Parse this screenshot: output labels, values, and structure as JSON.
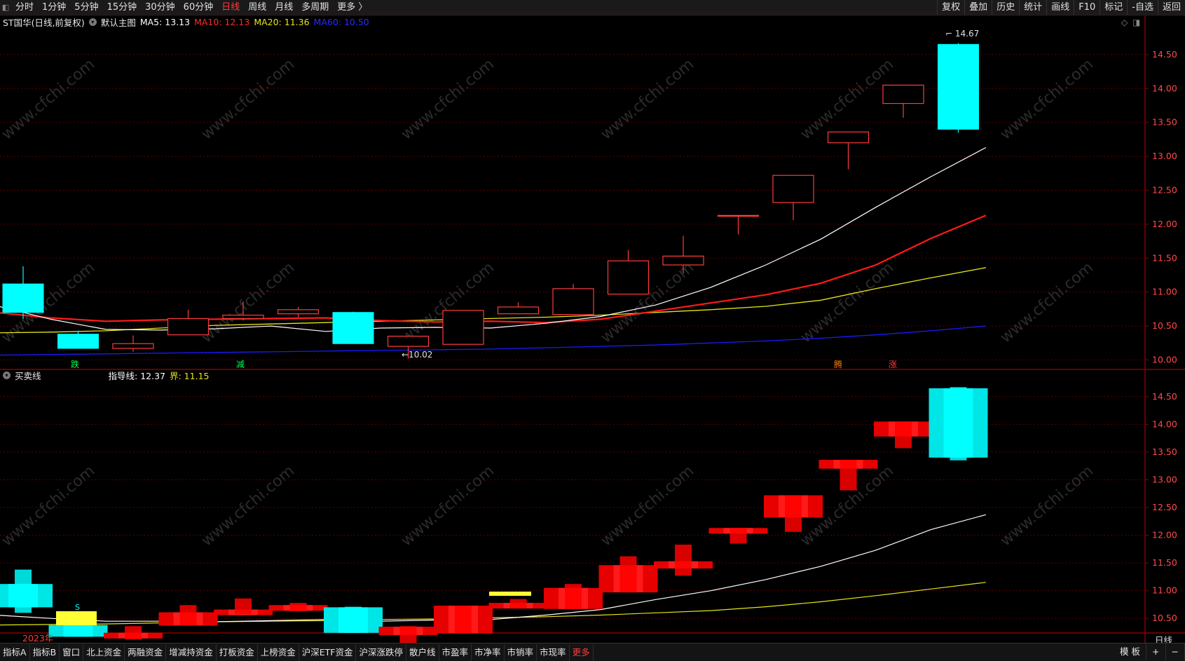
{
  "toolbar": {
    "periods": [
      "分时",
      "1分钟",
      "5分钟",
      "15分钟",
      "30分钟",
      "60分钟",
      "日线",
      "周线",
      "月线",
      "多周期",
      "更多 〉"
    ],
    "active_period": "日线",
    "right_items": [
      "复权",
      "叠加",
      "历史",
      "统计",
      "画线",
      "F10",
      "标记",
      "-自选",
      "返回"
    ]
  },
  "main_chart": {
    "stock_title": "ST国华(日线,前复权)",
    "template_label": "默认主图",
    "ma5_label": "MA5: 13.13",
    "ma10_label": "MA10: 12.13",
    "ma20_label": "MA20: 11.36",
    "ma60_label": "MA60: 10.50",
    "high_marker": "14.67",
    "low_marker": "10.02",
    "signals": [
      "跌",
      "减",
      "腾",
      "涨"
    ],
    "y_ticks": [
      "14.50",
      "14.00",
      "13.50",
      "13.00",
      "12.50",
      "12.00",
      "11.50",
      "11.00",
      "10.50",
      "10.00"
    ]
  },
  "sub_chart": {
    "title": "买卖线",
    "guide_label": "指导线: 12.37",
    "bound_label": "界: 11.15",
    "s_marker": "S",
    "y_ticks": [
      "14.50",
      "14.00",
      "13.50",
      "13.00",
      "12.50",
      "12.00",
      "11.50",
      "11.00",
      "10.50"
    ],
    "year_label": "2023年"
  },
  "period_label": "日线",
  "bottom_tabs": [
    "指标A",
    "指标B",
    "窗口",
    "北上资金",
    "两融资金",
    "增减持资金",
    "打板资金",
    "上榜资金",
    "沪深ETF资金",
    "沪深涨跌停",
    "散户线",
    "市盈率",
    "市净率",
    "市销率",
    "市现率",
    "更多"
  ],
  "bottom_right": [
    "模 板",
    "+",
    "−"
  ],
  "watermark": "www.cfchi.com",
  "colors": {
    "up": "#ff3b3b",
    "down": "#00ffff",
    "ma5": "#ffffff",
    "ma10": "#ff1a1a",
    "ma20": "#e5e51a",
    "ma60": "#1a1aff"
  },
  "chart_data": {
    "type": "candlestick",
    "ohlc": [
      [
        11.12,
        11.38,
        10.6,
        10.7
      ],
      [
        10.38,
        10.43,
        10.17,
        10.17
      ],
      [
        10.17,
        10.36,
        10.12,
        10.24
      ],
      [
        10.37,
        10.74,
        10.37,
        10.61
      ],
      [
        10.61,
        10.86,
        10.58,
        10.66
      ],
      [
        10.68,
        10.78,
        10.63,
        10.74
      ],
      [
        10.7,
        10.71,
        10.24,
        10.24
      ],
      [
        10.2,
        10.36,
        10.02,
        10.35
      ],
      [
        10.23,
        10.73,
        10.23,
        10.73
      ],
      [
        10.68,
        10.85,
        10.68,
        10.78
      ],
      [
        10.67,
        11.12,
        10.67,
        11.05
      ],
      [
        10.97,
        11.62,
        10.97,
        11.46
      ],
      [
        11.4,
        11.83,
        11.27,
        11.53
      ],
      [
        12.13,
        12.13,
        11.85,
        12.13
      ],
      [
        12.32,
        12.72,
        12.06,
        12.72
      ],
      [
        13.2,
        13.36,
        12.81,
        13.36
      ],
      [
        13.78,
        14.05,
        13.57,
        14.05
      ],
      [
        14.65,
        14.67,
        13.35,
        13.4
      ]
    ],
    "ma5": [
      10.8,
      10.6,
      10.45,
      10.44,
      10.46,
      10.5,
      10.42,
      10.47,
      10.48,
      10.47,
      10.54,
      10.64,
      10.81,
      11.07,
      11.4,
      11.78,
      12.25,
      12.7,
      13.13
    ],
    "ma10": [
      10.7,
      10.62,
      10.57,
      10.59,
      10.6,
      10.61,
      10.62,
      10.58,
      10.56,
      10.57,
      10.55,
      10.6,
      10.72,
      10.84,
      10.96,
      11.13,
      11.4,
      11.79,
      12.13
    ],
    "ma20": [
      10.4,
      10.41,
      10.43,
      10.47,
      10.51,
      10.53,
      10.55,
      10.57,
      10.59,
      10.61,
      10.63,
      10.66,
      10.7,
      10.74,
      10.79,
      10.88,
      11.05,
      11.21,
      11.36
    ],
    "ma60": [
      10.07,
      10.08,
      10.09,
      10.1,
      10.11,
      10.12,
      10.13,
      10.14,
      10.15,
      10.16,
      10.18,
      10.2,
      10.22,
      10.25,
      10.28,
      10.32,
      10.37,
      10.43,
      10.5
    ],
    "guide_line": [
      10.56,
      10.5,
      10.45,
      10.45,
      10.44,
      10.46,
      10.48,
      10.45,
      10.47,
      10.48,
      10.56,
      10.66,
      10.84,
      11.0,
      11.2,
      11.44,
      11.73,
      12.1,
      12.37
    ],
    "bound_line": [
      10.38,
      10.39,
      10.4,
      10.42,
      10.44,
      10.45,
      10.46,
      10.48,
      10.49,
      10.51,
      10.53,
      10.56,
      10.6,
      10.64,
      10.71,
      10.8,
      10.91,
      11.03,
      11.15
    ],
    "ylim_main": [
      9.85,
      14.85
    ],
    "ylim_sub": [
      10.25,
      14.75
    ]
  }
}
